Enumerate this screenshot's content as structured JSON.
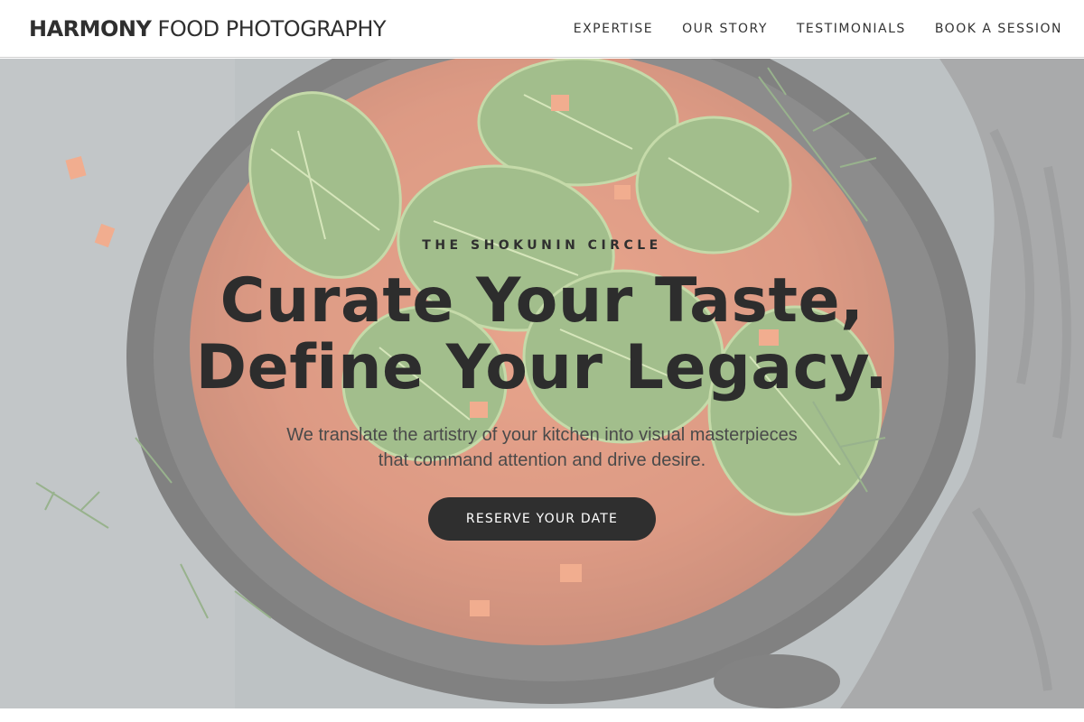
{
  "brand": {
    "bold": "HARMONY",
    "light": "FOOD PHOTOGRAPHY"
  },
  "nav": {
    "items": [
      "EXPERTISE",
      "OUR STORY",
      "TESTIMONIALS",
      "BOOK A SESSION"
    ]
  },
  "hero": {
    "eyebrow": "THE SHOKUNIN CIRCLE",
    "headline": [
      "Curate Your Taste,",
      "Define Your Legacy."
    ],
    "subtext": [
      "We translate the artistry of your kitchen into visual masterpieces",
      "that command attention and drive desire."
    ],
    "cta_label": "RESERVE YOUR DATE"
  },
  "colors": {
    "text_dark": "#2f2f2f",
    "cta_bg": "#2f2f2f",
    "cta_text": "#ffffff",
    "nav_bg": "#ffffff"
  }
}
